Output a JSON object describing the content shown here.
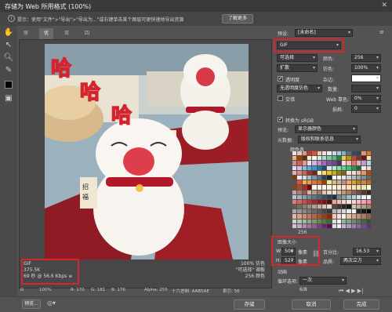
{
  "window": {
    "title": "存储为 Web 所用格式 (100%)",
    "close_icon": "close-icon"
  },
  "hint": {
    "text": "提示：使用\"文件\">\"导出\">\"导出为...\"或右键单击某个图层可更快速地导出资源",
    "learn_more": "了解更多"
  },
  "tabs": [
    "原稿",
    "优化",
    "双联",
    "四联"
  ],
  "tools": [
    "hand-icon",
    "slice-select-icon",
    "zoom-icon",
    "eyedropper-icon",
    "color-swatch-icon",
    "toggle-slices-icon"
  ],
  "image_text": {
    "text1": "哈",
    "text2": "哈",
    "text3": "哈",
    "sign1": "大",
    "sign2": "招",
    "sign3": "福"
  },
  "info_left": [
    "GIF",
    "375.5K",
    "69 秒 @ 56.6 Kbps"
  ],
  "info_left_menu": "≡",
  "info_right": [
    "100% 仿色",
    "\"可选择\" 调板",
    "256 颜色"
  ],
  "statusbar": {
    "zoom": "100%",
    "r": "R: 170",
    "g": "G: 181",
    "b": "B: 176",
    "alpha": "Alpha: 255",
    "hex": "十六进制: AAB5AE",
    "index": "索引: 56"
  },
  "panel": {
    "preset_label": "预设:",
    "preset_value": "[未命名]",
    "format_value": "GIF",
    "reduction_value": "可选择",
    "colors_label": "颜色:",
    "colors_value": "256",
    "dither_method": "扩散",
    "dither_label": "仿色:",
    "dither_value": "100%",
    "transparency_label": "透明度",
    "matte_label": "杂边:",
    "no_transparency_dither": "无透明度仿色",
    "amount_label": "数量:",
    "interlaced_label": "交错",
    "web_snap_label": "Web 靠色:",
    "web_snap_value": "0%",
    "lossy_label": "损耗:",
    "lossy_value": "0",
    "convert_srgb": "转换为 sRGB",
    "preview_label": "预览:",
    "preview_value": "显示器颜色",
    "metadata_label": "元数据:",
    "metadata_value": "版权和联系信息",
    "color_table_label": "颜色表",
    "color_count": "256",
    "image_size_label": "图像大小",
    "w_label": "W:",
    "w_value": "500",
    "w_unit": "像素",
    "h_label": "H:",
    "h_value": "527",
    "h_unit": "像素",
    "percent_label": "百分比:",
    "percent_value": "16.53",
    "quality_label": "品质:",
    "quality_value": "两次立方",
    "animation_label": "动画",
    "loop_label": "循环选项:",
    "loop_value": "一次",
    "frame_counter": "6/8"
  },
  "palette_colors": [
    "#f2e4dc",
    "#e8c9b8",
    "#d99a8a",
    "#c0392b",
    "#e74c3c",
    "#f5cba7",
    "#fadbd8",
    "#eaeded",
    "#d5d8dc",
    "#a9cce3",
    "#7fb3d5",
    "#5d6d7e",
    "#34495e",
    "#2e4053",
    "#e59866",
    "#dc7633",
    "#f0b27a",
    "#a04000",
    "#6e2c00",
    "#fdebd0",
    "#fef9e7",
    "#d4efdf",
    "#a9dfbf",
    "#7dcea0",
    "#52be80",
    "#1e8449",
    "#f4d03f",
    "#b7950b",
    "#cb4335",
    "#922b21",
    "#641e16",
    "#f9e79f",
    "#d98880",
    "#cd6155",
    "#f1948a",
    "#ebdef0",
    "#d2b4de",
    "#bb8fce",
    "#a569bd",
    "#884ea0",
    "#76448a",
    "#512e5f",
    "#fadbd8",
    "#f5b7b1",
    "#ec7063",
    "#e6b0aa",
    "#c39bd3",
    "#aed6f1",
    "#e8daef",
    "#d7bde2",
    "#85c1e9",
    "#5dade2",
    "#3498db",
    "#2874a6",
    "#1b4f72",
    "#d6eaf8",
    "#abebc6",
    "#82e0aa",
    "#58d68d",
    "#2ecc71",
    "#239b56",
    "#186a3b",
    "#f9ebea",
    "#f2d7d5",
    "#e6b0aa",
    "#d98880",
    "#cd6155",
    "#a93226",
    "#7b241c",
    "#fcf3cf",
    "#f7dc6f",
    "#f1c40f",
    "#d4ac0d",
    "#9a7d0a",
    "#7d6608",
    "#fae5d3",
    "#f6ddcc",
    "#edbb99",
    "#e59866",
    "#ba4a00",
    "#873600",
    "#ebedef",
    "#d6dbdf",
    "#aeb6bf",
    "#85929e",
    "#5d6d7e",
    "#2e4053",
    "#1b2631",
    "#f8f9f9",
    "#f2f3f4",
    "#e5e8e8",
    "#ccd1d1",
    "#b2babb",
    "#99a3a4",
    "#7f8c8d",
    "#616a6b",
    "#4d5656",
    "#e74c3c",
    "#f5b041",
    "#eb984e",
    "#dc7633",
    "#ca6f1e",
    "#a04000",
    "#f0e68c",
    "#deb887",
    "#d2b48c",
    "#bc8f8f",
    "#f4a460",
    "#daa520",
    "#b8860b",
    "#cd853f",
    "#d2691e",
    "#8b4513",
    "#a0522d",
    "#a52a2a",
    "#800000",
    "#fffaf0",
    "#faf0e6",
    "#fdf5e6",
    "#fff8dc",
    "#ffefd5",
    "#ffebcd",
    "#ffe4c4",
    "#ffdead",
    "#ffe4b5",
    "#f5deb3",
    "#eee8aa",
    "#fafad2",
    "#c8a2a2",
    "#b37a7a",
    "#8f5b5b",
    "#d4b6a4",
    "#c29b84",
    "#a67c65",
    "#e0c3b0",
    "#ecd5c5",
    "#f3e1d4",
    "#dcb9a0",
    "#c9967a",
    "#b07c63",
    "#92614c",
    "#764a38",
    "#5a3427",
    "#3e2219",
    "#b5c7cf",
    "#9fb3bd",
    "#8aa0ab",
    "#758c98",
    "#617986",
    "#4e6674",
    "#3c5462",
    "#2b4250",
    "#1c313e",
    "#6f8c8e",
    "#86a4a6",
    "#9dbcbe",
    "#b4d4d6",
    "#cbe8ea",
    "#e0f4f6",
    "#f0fafb",
    "#e37c7c",
    "#d86363",
    "#c94c4c",
    "#b83838",
    "#a42727",
    "#8f1a1a",
    "#7a1010",
    "#650808",
    "#f0a5a5",
    "#f4b9b9",
    "#f8cdcd",
    "#fbe0e0",
    "#ffd1dc",
    "#ffb6c1",
    "#ff9eb0",
    "#ff85a1",
    "#6b5b4f",
    "#7d6b5e",
    "#8f7c6d",
    "#a18d7d",
    "#b39f8f",
    "#c5b1a1",
    "#d7c4b4",
    "#e9d8c9",
    "#57473d",
    "#43362e",
    "#30271f",
    "#1e1813",
    "#d4c4a8",
    "#c2b094",
    "#b09c80",
    "#9e896d",
    "#a8a8a8",
    "#989898",
    "#888888",
    "#787878",
    "#686868",
    "#585858",
    "#484848",
    "#383838",
    "#b8b8b8",
    "#c8c8c8",
    "#d8d8d8",
    "#e8e8e8",
    "#f8f8f8",
    "#282828",
    "#181818",
    "#080808",
    "#e8b4a0",
    "#dca08a",
    "#d08c74",
    "#c4785e",
    "#b86448",
    "#ac5032",
    "#a03c1c",
    "#942806",
    "#f4c8b6",
    "#ffdccc",
    "#fff0e2",
    "#ebc0a8",
    "#d7a890",
    "#c39078",
    "#af7860",
    "#9b6048",
    "#c9d6c1",
    "#b5c7ab",
    "#a1b895",
    "#8da97f",
    "#799a69",
    "#658b53",
    "#517c3d",
    "#3d6d27",
    "#dde5d7",
    "#f1f4ed",
    "#96b496",
    "#82a082",
    "#6e8c6e",
    "#5a785a",
    "#466446",
    "#325032",
    "#d9c2d9",
    "#c7a8c7",
    "#b58eb5",
    "#a374a3",
    "#915a91",
    "#7f407f",
    "#6d266d",
    "#5b0c5b",
    "#ebdceb",
    "#f5eef5",
    "#c3b2d9",
    "#af98c7",
    "#9b7eb5",
    "#8764a3",
    "#734a91",
    "#5f307f"
  ]
}
